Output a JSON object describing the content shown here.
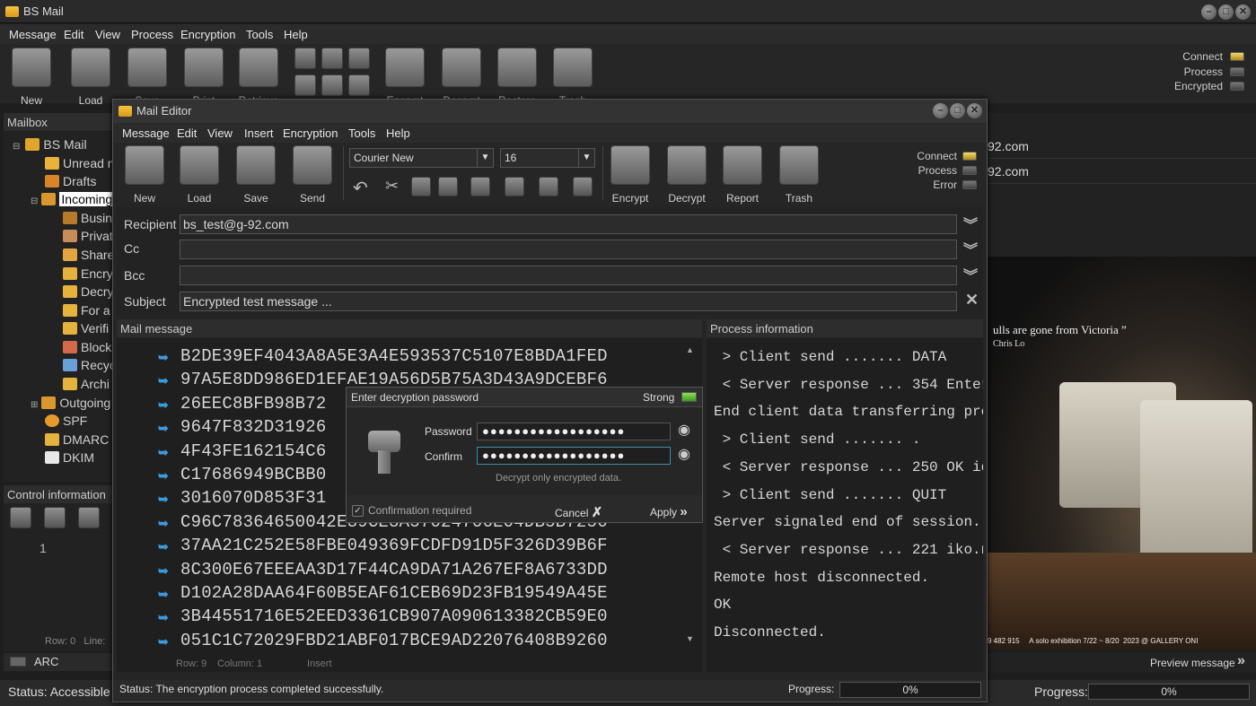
{
  "app": {
    "title": "BS Mail",
    "menu": [
      "Message",
      "Edit",
      "View",
      "Process",
      "Encryption",
      "Tools",
      "Help"
    ],
    "toolbar": [
      "New",
      "Load",
      "Save",
      "Print",
      "Retrieve",
      "Encrypt",
      "Decrypt",
      "Restore",
      "Trash"
    ],
    "indicators": [
      {
        "label": "Connect",
        "state": "on"
      },
      {
        "label": "Process",
        "state": "off"
      },
      {
        "label": "Encrypted",
        "state": "off"
      }
    ],
    "mailbox_header": "Mailbox",
    "tree": {
      "root": "BS Mail",
      "unread": "Unread m",
      "drafts": "Drafts",
      "incoming": "Incoming",
      "incoming_children": [
        "Busin",
        "Privat",
        "Share",
        "Encry",
        "Decry",
        "For a",
        "Verifi",
        "Block",
        "Recyc",
        "Archi"
      ],
      "outgoing": "Outgoing",
      "spf": "SPF",
      "dmarc": "DMARC",
      "dkim": "DKIM"
    },
    "control_info_header": "Control information",
    "control_line_number": "1",
    "control_status": "Row: 0   Line:",
    "arc_label": "ARC",
    "status_text": "Status:  Accessible",
    "progress_label": "Progress:",
    "progress_value": "0%",
    "list_snippets": [
      "92.com",
      "92.com"
    ],
    "preview": {
      "quote": "ulls are gone from Victoria ”",
      "author": "Chris Lo",
      "footer": "9 482 915     A solo exhibition 7/22 ~ 8/20  2023 @ GALLERY ONI",
      "label": "Preview message"
    }
  },
  "editor": {
    "title": "Mail Editor",
    "menu": [
      "Message",
      "Edit",
      "View",
      "Insert",
      "Encryption",
      "Tools",
      "Help"
    ],
    "toolbar_left": [
      "New",
      "Load",
      "Save",
      "Send"
    ],
    "toolbar_right": [
      "Encrypt",
      "Decrypt",
      "Report",
      "Trash"
    ],
    "font_name": "Courier New",
    "font_size": "16",
    "indicators": [
      {
        "label": "Connect",
        "state": "on"
      },
      {
        "label": "Process",
        "state": "off"
      },
      {
        "label": "Error",
        "state": "off"
      }
    ],
    "fields": {
      "recipient_label": "Recipient",
      "recipient_value": "bs_test@g-92.com",
      "cc_label": "Cc",
      "cc_value": "",
      "bcc_label": "Bcc",
      "bcc_value": "",
      "subject_label": "Subject",
      "subject_value": "Encrypted test message ..."
    },
    "mail_message_header": "Mail message",
    "hex_lines": [
      "B2DE39EF4043A8A5E3A4E593537C5107E8BDA1FED",
      "97A5E8DD986ED1EFAE19A56D5B75A3D43A9DCEBF6",
      "26EEC8BFB98B72",
      "9647F832D31926",
      "4F43FE162154C6",
      "C17686949BCBB0",
      "3016070D853F31",
      "C96C78364650042E39CE3A57024706E04DB5B7256",
      "37AA21C252E58FBE049369FCDFD91D5F326D39B6F",
      "8C300E67EEEAA3D17F44CA9DA71A267EF8A6733DD",
      "D102A28DAA64F60B5EAF61CEB69D23FB19549A45E",
      "3B44551716E52EED3361CB907A090613382CB59E0",
      "051C1C72029FBD21ABF017BCE9AD22076408B9260"
    ],
    "cursor_status": {
      "row": "Row: 9",
      "column": "Column: 1",
      "mode": "Insert"
    },
    "process_header": "Process information",
    "process_lines": [
      " > Client send ....... DATA",
      " < Server response ... 354 Enter",
      "End client data transferring pro",
      " > Client send ....... .",
      " < Server response ... 250 OK id",
      " > Client send ....... QUIT",
      "Server signaled end of session.",
      " < Server response ... 221 iko.n",
      "Remote host disconnected.",
      "OK",
      "Disconnected."
    ],
    "status_text": "Status:  The encryption process completed successfully.",
    "progress_label": "Progress:",
    "progress_value": "0%"
  },
  "dialog": {
    "title": "Enter decryption password",
    "strength": "Strong",
    "password_label": "Password",
    "password_value": "●●●●●●●●●●●●●●●●●●",
    "confirm_label": "Confirm",
    "confirm_value": "●●●●●●●●●●●●●●●●●●",
    "note": "Decrypt only encrypted data.",
    "confirm_required": "Confirmation required",
    "cancel": "Cancel",
    "apply": "Apply"
  },
  "colors": {
    "accent_blue": "#3b9be0",
    "led_on": "#e0c24a",
    "strong": "#5dbb2f"
  }
}
